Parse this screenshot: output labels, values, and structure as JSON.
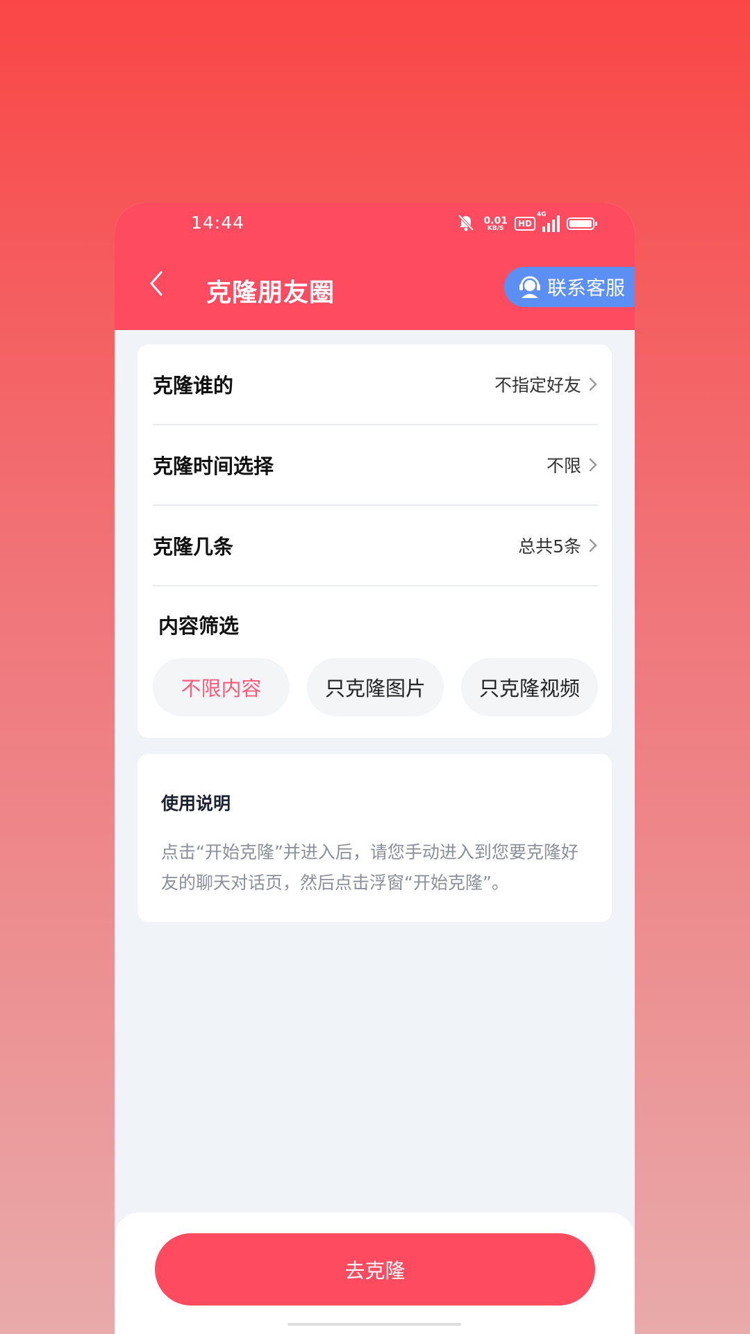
{
  "status_bar": {
    "time": "14:44",
    "net_speed_value": "0.01",
    "net_speed_unit": "KB/S",
    "hd": "HD",
    "network": "4G",
    "icons": [
      "mute-bell-icon",
      "hd-icon",
      "signal-icon",
      "battery-icon"
    ]
  },
  "header": {
    "title": "克隆朋友圈",
    "contact_service": "联系客服",
    "colors": {
      "header_bg": "#ff4b60",
      "contact_bg": "#5b8ff3"
    }
  },
  "settings": {
    "rows": [
      {
        "label": "克隆谁的",
        "value": "不指定好友"
      },
      {
        "label": "克隆时间选择",
        "value": "不限"
      },
      {
        "label": "克隆几条",
        "value": "总共5条"
      }
    ],
    "filter_title": "内容筛选",
    "chips": [
      {
        "label": "不限内容",
        "active": true
      },
      {
        "label": "只克隆图片",
        "active": false
      },
      {
        "label": "只克隆视频",
        "active": false
      }
    ]
  },
  "instructions": {
    "title": "使用说明",
    "body": "点击“开始克隆”并进入后，请您手动进入到您要克隆好友的聊天对话页，然后点击浮窗“开始克隆”。"
  },
  "footer": {
    "primary_button": "去克隆",
    "accent": "#ff4b60",
    "active_chip_color": "#ff5a7a"
  }
}
